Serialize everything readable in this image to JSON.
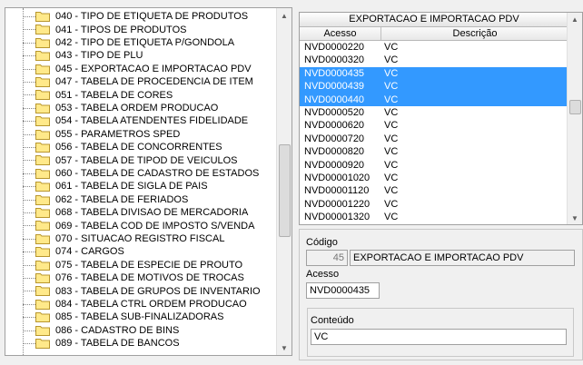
{
  "tree": {
    "items": [
      "040 - TIPO DE ETIQUETA DE PRODUTOS",
      "041 - TIPOS DE PRODUTOS",
      "042 - TIPO DE ETIQUETA P/GONDOLA",
      "043 - TIPO DE PLU",
      "045 - EXPORTACAO E IMPORTACAO PDV",
      "047 - TABELA DE PROCEDENCIA DE ITEM",
      "051 - TABELA DE CORES",
      "053 - TABELA ORDEM PRODUCAO",
      "054 - TABELA ATENDENTES FIDELIDADE",
      "055 - PARAMETROS SPED",
      "056 - TABELA DE CONCORRENTES",
      "057 - TABELA DE TIPOD DE VEICULOS",
      "060 - TABELA DE CADASTRO DE ESTADOS",
      "061 - TABELA DE SIGLA DE PAIS",
      "062 - TABELA DE FERIADOS",
      "068 - TABELA  DIVISAO DE MERCADORIA",
      "069 - TABELA COD DE IMPOSTO S/VENDA",
      "070 - SITUACAO REGISTRO FISCAL",
      "074 - CARGOS",
      "075 - TABELA DE ESPECIE DE PROUTO",
      "076 - TABELA DE MOTIVOS DE TROCAS",
      "083 - TABELA DE GRUPOS DE INVENTARIO",
      "084 - TABELA CTRL ORDEM PRODUCAO",
      "085 - TABELA SUB-FINALIZADORAS",
      "086 - CADASTRO DE BINS",
      "089 - TABELA DE BANCOS"
    ]
  },
  "grid": {
    "title": "EXPORTACAO E IMPORTACAO PDV",
    "col_acesso": "Acesso",
    "col_descricao": "Descrição",
    "rows": [
      {
        "acesso": "NVD0000220",
        "descricao": "VC",
        "selected": false
      },
      {
        "acesso": "NVD0000320",
        "descricao": "VC",
        "selected": false
      },
      {
        "acesso": "NVD0000435",
        "descricao": "VC",
        "selected": true
      },
      {
        "acesso": "NVD0000439",
        "descricao": "VC",
        "selected": true
      },
      {
        "acesso": "NVD0000440",
        "descricao": "VC",
        "selected": true
      },
      {
        "acesso": "NVD0000520",
        "descricao": "VC",
        "selected": false
      },
      {
        "acesso": "NVD0000620",
        "descricao": "VC",
        "selected": false
      },
      {
        "acesso": "NVD0000720",
        "descricao": "VC",
        "selected": false
      },
      {
        "acesso": "NVD0000820",
        "descricao": "VC",
        "selected": false
      },
      {
        "acesso": "NVD0000920",
        "descricao": "VC",
        "selected": false
      },
      {
        "acesso": "NVD00001020",
        "descricao": "VC",
        "selected": false
      },
      {
        "acesso": "NVD00001120",
        "descricao": "VC",
        "selected": false
      },
      {
        "acesso": "NVD00001220",
        "descricao": "VC",
        "selected": false
      },
      {
        "acesso": "NVD00001320",
        "descricao": "VC",
        "selected": false
      }
    ]
  },
  "detail": {
    "codigo_label": "Código",
    "codigo_value": "45",
    "codigo_desc": "EXPORTACAO E IMPORTACAO PDV",
    "acesso_label": "Acesso",
    "acesso_value": "NVD0000435",
    "conteudo_label": "Conteúdo",
    "conteudo_value": "VC"
  },
  "icons": {
    "tree_item": "folder-icon",
    "scroll_up": "arrow-up-icon",
    "scroll_down": "arrow-down-icon"
  },
  "colors": {
    "selection": "#3399ff",
    "folder_fill": "#ffe98a"
  }
}
